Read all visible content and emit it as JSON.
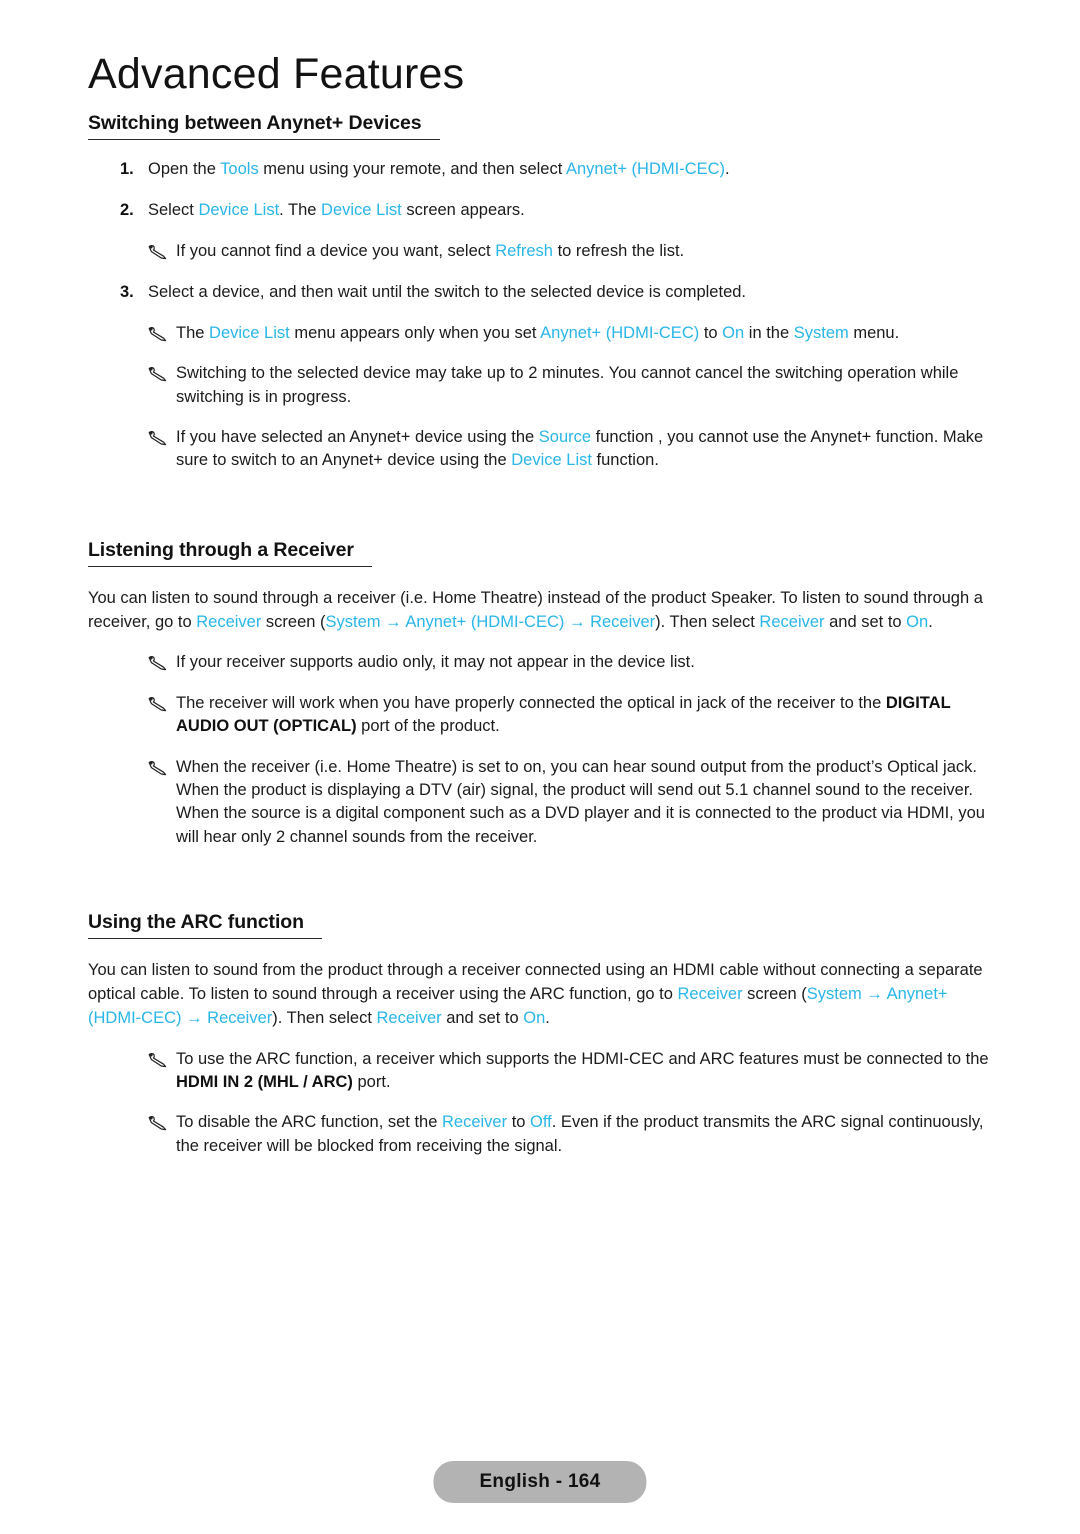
{
  "page": {
    "chapter_title": "Advanced Features",
    "footer_label": "English - 164",
    "accent_color": "#29b6e8",
    "footer_pill_color": "#b3b3b3"
  },
  "sections": {
    "switching": {
      "heading": "Switching between Anynet+ Devices",
      "steps": [
        {
          "num": "1.",
          "parts": [
            {
              "t": "Open the ",
              "s": "n"
            },
            {
              "t": "Tools",
              "s": "k"
            },
            {
              "t": " menu using your remote, and then select ",
              "s": "n"
            },
            {
              "t": "Anynet+ (HDMI-CEC)",
              "s": "k"
            },
            {
              "t": ".",
              "s": "n"
            }
          ]
        },
        {
          "num": "2.",
          "parts": [
            {
              "t": "Select ",
              "s": "n"
            },
            {
              "t": "Device List",
              "s": "k"
            },
            {
              "t": ". The ",
              "s": "n"
            },
            {
              "t": "Device List",
              "s": "k"
            },
            {
              "t": " screen appears.",
              "s": "n"
            }
          ]
        },
        {
          "num": "3.",
          "parts": [
            {
              "t": "Select a device, and then wait until the switch to the selected device is completed.",
              "s": "n"
            }
          ]
        }
      ],
      "note_after_step2": [
        {
          "t": "If you cannot find a device you want, select ",
          "s": "n"
        },
        {
          "t": "Refresh",
          "s": "k"
        },
        {
          "t": " to refresh the list.",
          "s": "n"
        }
      ],
      "notes": [
        [
          {
            "t": "The ",
            "s": "n"
          },
          {
            "t": "Device List",
            "s": "k"
          },
          {
            "t": " menu appears only when you set ",
            "s": "n"
          },
          {
            "t": "Anynet+ (HDMI-CEC)",
            "s": "k"
          },
          {
            "t": " to ",
            "s": "n"
          },
          {
            "t": "On",
            "s": "k"
          },
          {
            "t": " in the ",
            "s": "n"
          },
          {
            "t": "System",
            "s": "k"
          },
          {
            "t": " menu.",
            "s": "n"
          }
        ],
        [
          {
            "t": "Switching to the selected device may take up to 2 minutes. You cannot cancel the switching operation while switching is in progress.",
            "s": "n"
          }
        ],
        [
          {
            "t": "If you have selected an Anynet+ device using the ",
            "s": "n"
          },
          {
            "t": "Source",
            "s": "k"
          },
          {
            "t": " function , you cannot use the Anynet+ function. Make sure to switch to an Anynet+ device using the ",
            "s": "n"
          },
          {
            "t": "Device List",
            "s": "k"
          },
          {
            "t": " function.",
            "s": "n"
          }
        ]
      ]
    },
    "receiver": {
      "heading": "Listening through a Receiver",
      "body": [
        {
          "t": "You can listen to sound through a receiver (i.e. Home Theatre) instead of the product Speaker. To listen to sound through a receiver, go to ",
          "s": "n"
        },
        {
          "t": "Receiver",
          "s": "k"
        },
        {
          "t": " screen (",
          "s": "n"
        },
        {
          "t": "System",
          "s": "k"
        },
        {
          "t": " → ",
          "s": "k"
        },
        {
          "t": "Anynet+ (HDMI-CEC)",
          "s": "k"
        },
        {
          "t": " → ",
          "s": "k"
        },
        {
          "t": "Receiver",
          "s": "k"
        },
        {
          "t": "). Then select ",
          "s": "n"
        },
        {
          "t": "Receiver",
          "s": "k"
        },
        {
          "t": " and set to ",
          "s": "n"
        },
        {
          "t": "On",
          "s": "k"
        },
        {
          "t": ".",
          "s": "n"
        }
      ],
      "notes": [
        [
          {
            "t": "If your receiver supports audio only, it may not appear in the device list.",
            "s": "n"
          }
        ],
        [
          {
            "t": "The receiver will work when you have properly connected the optical in jack of the receiver to the ",
            "s": "n"
          },
          {
            "t": "DIGITAL AUDIO OUT (OPTICAL)",
            "s": "b"
          },
          {
            "t": " port of the product.",
            "s": "n"
          }
        ],
        [
          {
            "t": "When the receiver (i.e. Home Theatre) is set to on, you can hear sound output from the product’s Optical jack. When the product is displaying a DTV (air) signal, the product will send out 5.1 channel sound to the receiver. When the source is a digital component such as a DVD player and it is connected to the product via HDMI, you will hear only 2 channel sounds from the receiver.",
            "s": "n"
          }
        ]
      ]
    },
    "arc": {
      "heading": "Using the ARC function",
      "body": [
        {
          "t": "You can listen to sound from the product through a receiver connected using an HDMI cable without connecting a separate optical cable. To listen to sound through a receiver using the ARC function, go to ",
          "s": "n"
        },
        {
          "t": "Receiver",
          "s": "k"
        },
        {
          "t": " screen (",
          "s": "n"
        },
        {
          "t": "System",
          "s": "k"
        },
        {
          "t": " → ",
          "s": "k"
        },
        {
          "t": "Anynet+ (HDMI-CEC)",
          "s": "k"
        },
        {
          "t": " → ",
          "s": "k"
        },
        {
          "t": "Receiver",
          "s": "k"
        },
        {
          "t": "). Then select ",
          "s": "n"
        },
        {
          "t": "Receiver",
          "s": "k"
        },
        {
          "t": " and set to ",
          "s": "n"
        },
        {
          "t": "On",
          "s": "k"
        },
        {
          "t": ".",
          "s": "n"
        }
      ],
      "notes": [
        [
          {
            "t": "To use the ARC function, a receiver which supports the HDMI-CEC and ARC features must be connected to the ",
            "s": "n"
          },
          {
            "t": "HDMI IN 2 (MHL / ARC)",
            "s": "b"
          },
          {
            "t": " port.",
            "s": "n"
          }
        ],
        [
          {
            "t": "To disable the ARC function, set the ",
            "s": "n"
          },
          {
            "t": "Receiver",
            "s": "k"
          },
          {
            "t": " to ",
            "s": "n"
          },
          {
            "t": "Off",
            "s": "k"
          },
          {
            "t": ". Even if the product transmits the ARC signal continuously, the receiver will be blocked from receiving the signal.",
            "s": "n"
          }
        ]
      ]
    }
  }
}
